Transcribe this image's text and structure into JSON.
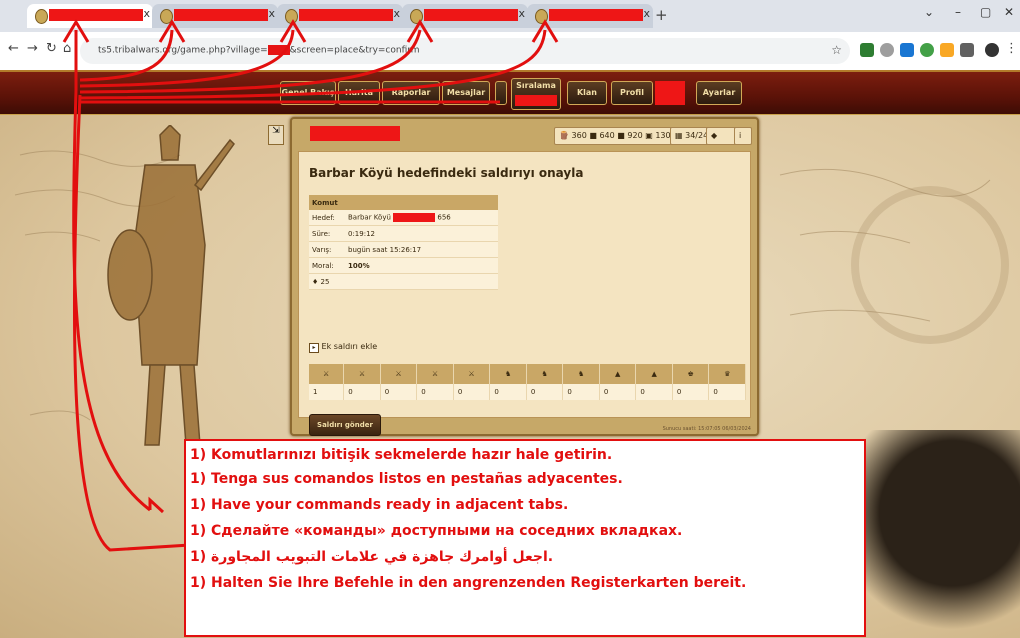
{
  "browser": {
    "tabs": [
      {
        "close": "x"
      },
      {
        "close": "x"
      },
      {
        "close": "x"
      },
      {
        "close": "x"
      },
      {
        "close": "x"
      }
    ],
    "new_tab": "+",
    "url": "ts5.tribalwars.org/game.php?village=",
    "url_suffix": "&screen=place&try=confirm",
    "window_controls": [
      "⌄",
      "–",
      "▢",
      "✕"
    ]
  },
  "game_nav": {
    "items": [
      "Genel Bakış",
      "Harita",
      "Raporlar",
      "Mesajlar",
      "Sıralama",
      "Klan",
      "Profil",
      "Ayarlar"
    ]
  },
  "resources": {
    "wood": "360",
    "clay": "640",
    "iron": "920",
    "storage": "1300",
    "population": "34/240"
  },
  "panel": {
    "title": "Barbar Köyü hedefindeki saldırıyı onayla",
    "command": {
      "header": "Komut",
      "rows": [
        {
          "label": "Hedef:",
          "value": "Barbar Köyü",
          "value_suffix": "656"
        },
        {
          "label": "Süre:",
          "value": "0:19:12"
        },
        {
          "label": "Varış:",
          "value": "bugün saat 15:26:17"
        },
        {
          "label": "Moral:",
          "value": "100%"
        }
      ],
      "haul": "25"
    },
    "extra_attack": "Ek saldırı ekle",
    "units": [
      "1",
      "0",
      "0",
      "0",
      "0",
      "0",
      "0",
      "0",
      "0",
      "0",
      "0",
      "0"
    ],
    "send_button": "Saldırı gönder",
    "server_time": "Sunucu saati: 15:07:05 06/03/2024"
  },
  "message": {
    "lines": [
      "1) Komutlarınızı bitişik sekmelerde hazır hale getirin.",
      "1) Tenga sus comandos listos en pestañas adyacentes.",
      "1) Have your commands ready in adjacent tabs.",
      "1) Сделайте «команды» доступными на соседних вкладках.",
      "1) اجعل أوامرك جاهزة في علامات التبويب المجاورة.",
      "1) Halten Sie Ihre Befehle in den angrenzenden Registerkarten bereit."
    ]
  },
  "colors": {
    "annotation_red": "#e20f0f",
    "redaction": "#ee1616",
    "game_bar": "#6b1a0c",
    "panel_bg": "#f4e4c1"
  }
}
